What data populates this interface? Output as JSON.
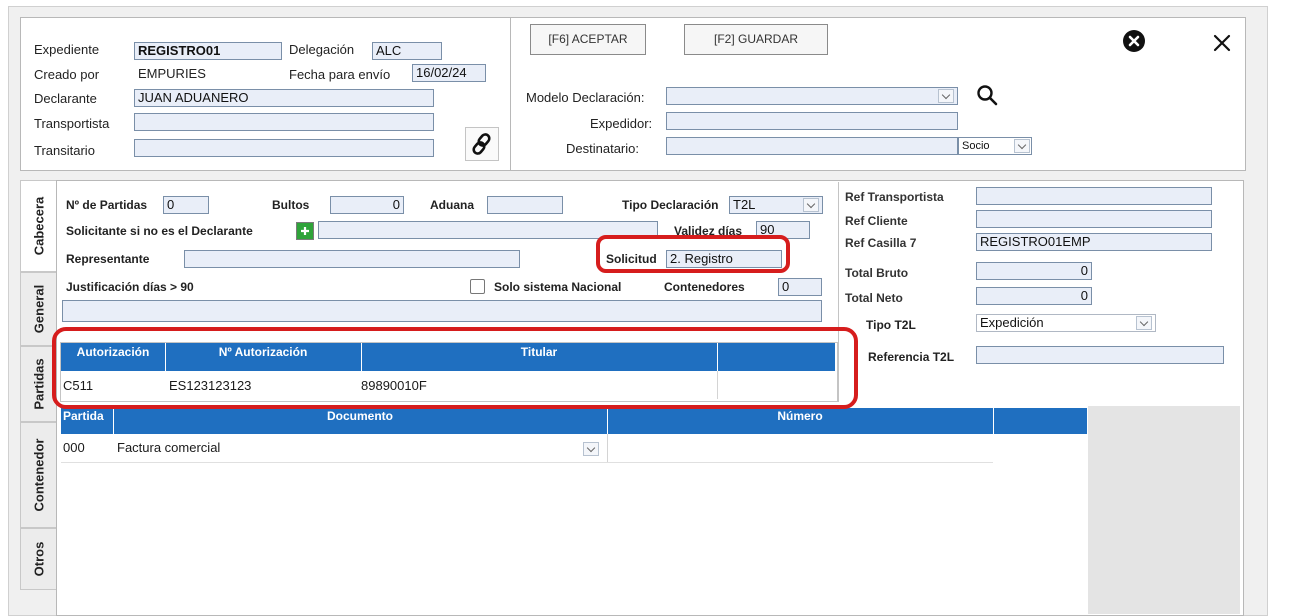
{
  "header": {
    "expediente_label": "Expediente",
    "expediente_value": "REGISTRO01",
    "delegacion_label": "Delegación",
    "delegacion_value": "ALC",
    "creado_label": "Creado por",
    "creado_value": "EMPURIES",
    "fecha_label": "Fecha para envío",
    "fecha_value": "16/02/24",
    "declarante_label": "Declarante",
    "declarante_value": "JUAN ADUANERO",
    "transportista_label": "Transportista",
    "transportista_value": "",
    "transitario_label": "Transitario",
    "transitario_value": ""
  },
  "toolbar": {
    "aceptar_label": "[F6] ACEPTAR",
    "guardar_label": "[F2] GUARDAR"
  },
  "declaracion": {
    "modelo_label": "Modelo Declaración:",
    "modelo_value": "",
    "expedidor_label": "Expedidor:",
    "expedidor_value": "",
    "destinatario_label": "Destinatario:",
    "destinatario_value": "",
    "socio_value": "Socio"
  },
  "tabs": [
    "Cabecera",
    "General",
    "Partidas",
    "Contenedor",
    "Otros"
  ],
  "cabecera": {
    "partidas_label": "Nº de Partidas",
    "partidas_value": "0",
    "bultos_label": "Bultos",
    "bultos_value": "0",
    "aduana_label": "Aduana",
    "aduana_value": "",
    "tipo_decl_label": "Tipo Declaración",
    "tipo_decl_value": "T2L",
    "solicitante_label": "Solicitante si no es el Declarante",
    "solicitante_value": "",
    "validez_label": "Validez días",
    "validez_value": "90",
    "representante_label": "Representante",
    "representante_value": "",
    "solicitud_label": "Solicitud",
    "solicitud_value": "2. Registro",
    "justificacion_label": "Justificación días > 90",
    "solo_nacional_label": "Solo sistema Nacional",
    "contenedores_label": "Contenedores",
    "contenedores_value": "0",
    "justificacion_value": ""
  },
  "autorizaciones": {
    "columns": [
      "Autorización",
      "Nº Autorización",
      "Titular"
    ],
    "rows": [
      {
        "autorizacion": "C511",
        "numero": "ES123123123",
        "titular": "89890010F"
      }
    ]
  },
  "documentos": {
    "columns": [
      "Partida",
      "Documento",
      "Número"
    ],
    "rows": [
      {
        "partida": "000",
        "documento": "Factura comercial",
        "numero": ""
      }
    ]
  },
  "referencias": {
    "ref_transportista_label": "Ref Transportista",
    "ref_transportista_value": "",
    "ref_cliente_label": "Ref Cliente",
    "ref_cliente_value": "",
    "ref_casilla_label": "Ref Casilla 7",
    "ref_casilla_value": "REGISTRO01EMP",
    "total_bruto_label": "Total Bruto",
    "total_bruto_value": "0",
    "total_neto_label": "Total Neto",
    "total_neto_value": "0",
    "tipo_t2l_label": "Tipo T2L",
    "tipo_t2l_value": "Expedición",
    "referencia_t2l_label": "Referencia T2L",
    "referencia_t2l_value": ""
  },
  "colors": {
    "table_header": "#1f6fc0",
    "highlight": "#d61d1d",
    "field_bg": "#e9eef8"
  }
}
